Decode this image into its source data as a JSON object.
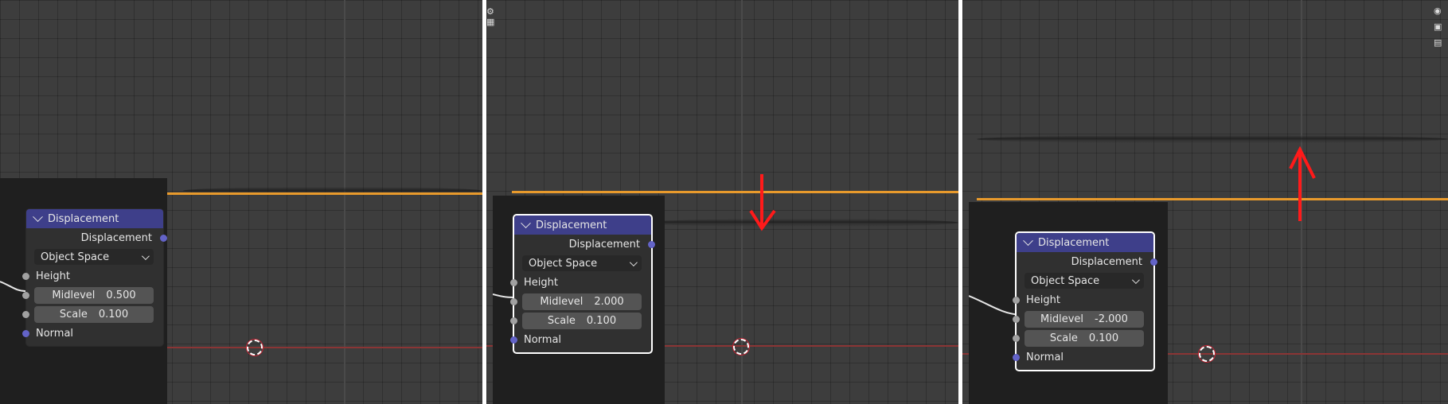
{
  "panels": [
    {
      "node": {
        "title": "Displacement",
        "output": "Displacement",
        "space": "Object Space",
        "height_label": "Height",
        "midlevel_label": "Midlevel",
        "midlevel_value": "0.500",
        "scale_label": "Scale",
        "scale_value": "0.100",
        "normal_label": "Normal"
      }
    },
    {
      "node": {
        "title": "Displacement",
        "output": "Displacement",
        "space": "Object Space",
        "height_label": "Height",
        "midlevel_label": "Midlevel",
        "midlevel_value": "2.000",
        "scale_label": "Scale",
        "scale_value": "0.100",
        "normal_label": "Normal"
      },
      "annotation": "down-arrow-icon"
    },
    {
      "node": {
        "title": "Displacement",
        "output": "Displacement",
        "space": "Object Space",
        "height_label": "Height",
        "midlevel_label": "Midlevel",
        "midlevel_value": "-2.000",
        "scale_label": "Scale",
        "scale_value": "0.100",
        "normal_label": "Normal"
      },
      "annotation": "up-arrow-icon"
    }
  ],
  "colors": {
    "node_header": "#3e3f8a",
    "orange_plane": "#e89a2c",
    "arrow": "#ff1a1a",
    "socket_grey": "#a1a1a1",
    "socket_blue": "#6363c7"
  }
}
